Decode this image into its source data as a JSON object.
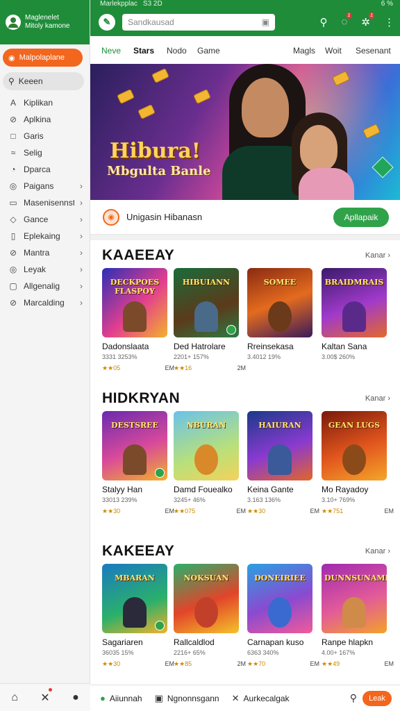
{
  "status_bar": {
    "left": "Marlekpplac",
    "time": "S3 2D",
    "right": "6 %"
  },
  "sidebar": {
    "header_line1": "Maglenelet",
    "header_line2": "Mitoly kamone",
    "cta_label": "Malpolaplane",
    "search_label": "Keeen",
    "items": [
      {
        "label": "Kiplikan",
        "icon": "A",
        "has_chevron": false
      },
      {
        "label": "Aplkina",
        "icon": "⊘",
        "has_chevron": false
      },
      {
        "label": "Garis",
        "icon": "□",
        "has_chevron": false
      },
      {
        "label": "Selig",
        "icon": "≈",
        "has_chevron": false
      },
      {
        "label": "Dparca",
        "icon": "◔",
        "has_chevron": false
      },
      {
        "label": "Paigans",
        "icon": "◎",
        "has_chevron": true
      },
      {
        "label": "Masenisennst",
        "icon": "▭",
        "has_chevron": true
      },
      {
        "label": "Gance",
        "icon": "◇",
        "has_chevron": true
      },
      {
        "label": "Eplekaing",
        "icon": "▯",
        "has_chevron": true
      },
      {
        "label": "Mantra",
        "icon": "⊘",
        "has_chevron": true
      },
      {
        "label": "Leyak",
        "icon": "◎",
        "has_chevron": true
      },
      {
        "label": "Allgenalig",
        "icon": "▢",
        "has_chevron": true
      },
      {
        "label": "Marcalding",
        "icon": "⊘",
        "has_chevron": true
      }
    ]
  },
  "topbar": {
    "search_placeholder": "Sandkausad",
    "notification_badge_1": "1",
    "notification_badge_2": "1"
  },
  "tabs": [
    "Neve",
    "Stars",
    "Nodo",
    "Game",
    "Magls",
    "Woit",
    "Sesenant"
  ],
  "banner": {
    "title": "Hibura!",
    "subtitle": "Mbgulta Banle"
  },
  "promo": {
    "text": "Unigasin Hibanasn",
    "button_label": "Apllapaik"
  },
  "sections": [
    {
      "title": "KAAEEAY",
      "more_label": "Kanar",
      "cards": [
        {
          "thumb_text": "DECKPOES FLASPOY",
          "name": "Dadonslaata",
          "meta": "3331 3253%",
          "rating": "★★05",
          "size": "EM"
        },
        {
          "thumb_text": "HIBUIANN",
          "name": "Ded Hatrolare",
          "meta": "2201+ 157%",
          "rating": "★★16",
          "size": "2M"
        },
        {
          "thumb_text": "SOMEE",
          "name": "Rreinsekasa",
          "meta": "3.4012 19%",
          "rating": "",
          "size": ""
        },
        {
          "thumb_text": "BRAIDMRAIS",
          "name": "Kaltan Sana",
          "meta": "3.00$ 260%",
          "rating": "",
          "size": ""
        }
      ]
    },
    {
      "title": "HIDKRYAN",
      "more_label": "Kanar",
      "cards": [
        {
          "thumb_text": "DESTSREE",
          "name": "Stalyy Han",
          "meta": "33013 239%",
          "rating": "★★30",
          "size": "EM"
        },
        {
          "thumb_text": "NBURAN",
          "name": "Damd Fouealko",
          "meta": "3245+ 46%",
          "rating": "★★075",
          "size": "EM"
        },
        {
          "thumb_text": "HAIURAN",
          "name": "Keina Gante",
          "meta": "3.163 136%",
          "rating": "★★30",
          "size": "EM"
        },
        {
          "thumb_text": "GEAN LUGS",
          "name": "Mo Rayadoy",
          "meta": "3.10+ 769%",
          "rating": "★★751",
          "size": "EM"
        }
      ]
    },
    {
      "title": "KAKEEAY",
      "more_label": "Kanar",
      "cards": [
        {
          "thumb_text": "MBARAN",
          "name": "Sagariaren",
          "meta": "36035 15%",
          "rating": "★★30",
          "size": "EM"
        },
        {
          "thumb_text": "NOKSUAN",
          "name": "Rallcaldlod",
          "meta": "2216+ 65%",
          "rating": "★★85",
          "size": "2M"
        },
        {
          "thumb_text": "DONEIRIEE",
          "name": "Carnapan kuso",
          "meta": "6363 340%",
          "rating": "★★70",
          "size": "EM"
        },
        {
          "thumb_text": "DUNNSUNAMINE",
          "name": "Ranpe hlapkn",
          "meta": "4.00+ 167%",
          "rating": "★★49",
          "size": "EM"
        }
      ]
    }
  ],
  "bottom_nav": {
    "items": [
      "Aiiunnah",
      "Ngnonnsgann",
      "Aurkecalgak"
    ],
    "button_label": "Leak"
  },
  "colors": {
    "brand_green": "#1f8c3a",
    "accent_orange": "#f2661e",
    "button_green": "#2fa24a"
  }
}
